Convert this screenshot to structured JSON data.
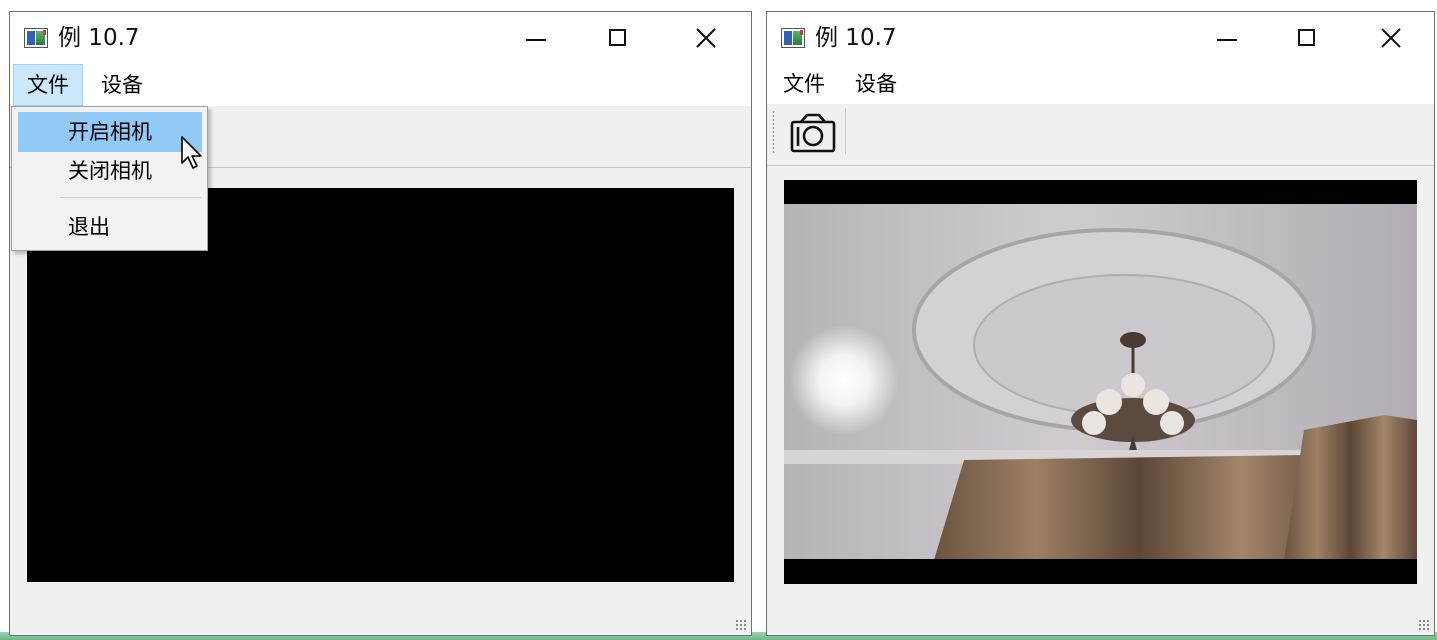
{
  "windows": [
    {
      "title": "例 10.7",
      "menu": [
        "文件",
        "设备"
      ],
      "dropdown": {
        "items": [
          "开启相机",
          "关闭相机",
          "退出"
        ],
        "highlighted": "开启相机"
      },
      "video_state": "black-frame"
    },
    {
      "title": "例 10.7",
      "menu": [
        "文件",
        "设备"
      ],
      "toolbar": {
        "button_icon": "camera-icon"
      },
      "video_state": "live-camera-feed"
    }
  ],
  "colors": {
    "menu_active_bg": "#cce8ff",
    "menu_highlight_bg": "#91c9f7",
    "client_bg": "#f0f0f0",
    "video_bg": "#000000"
  }
}
